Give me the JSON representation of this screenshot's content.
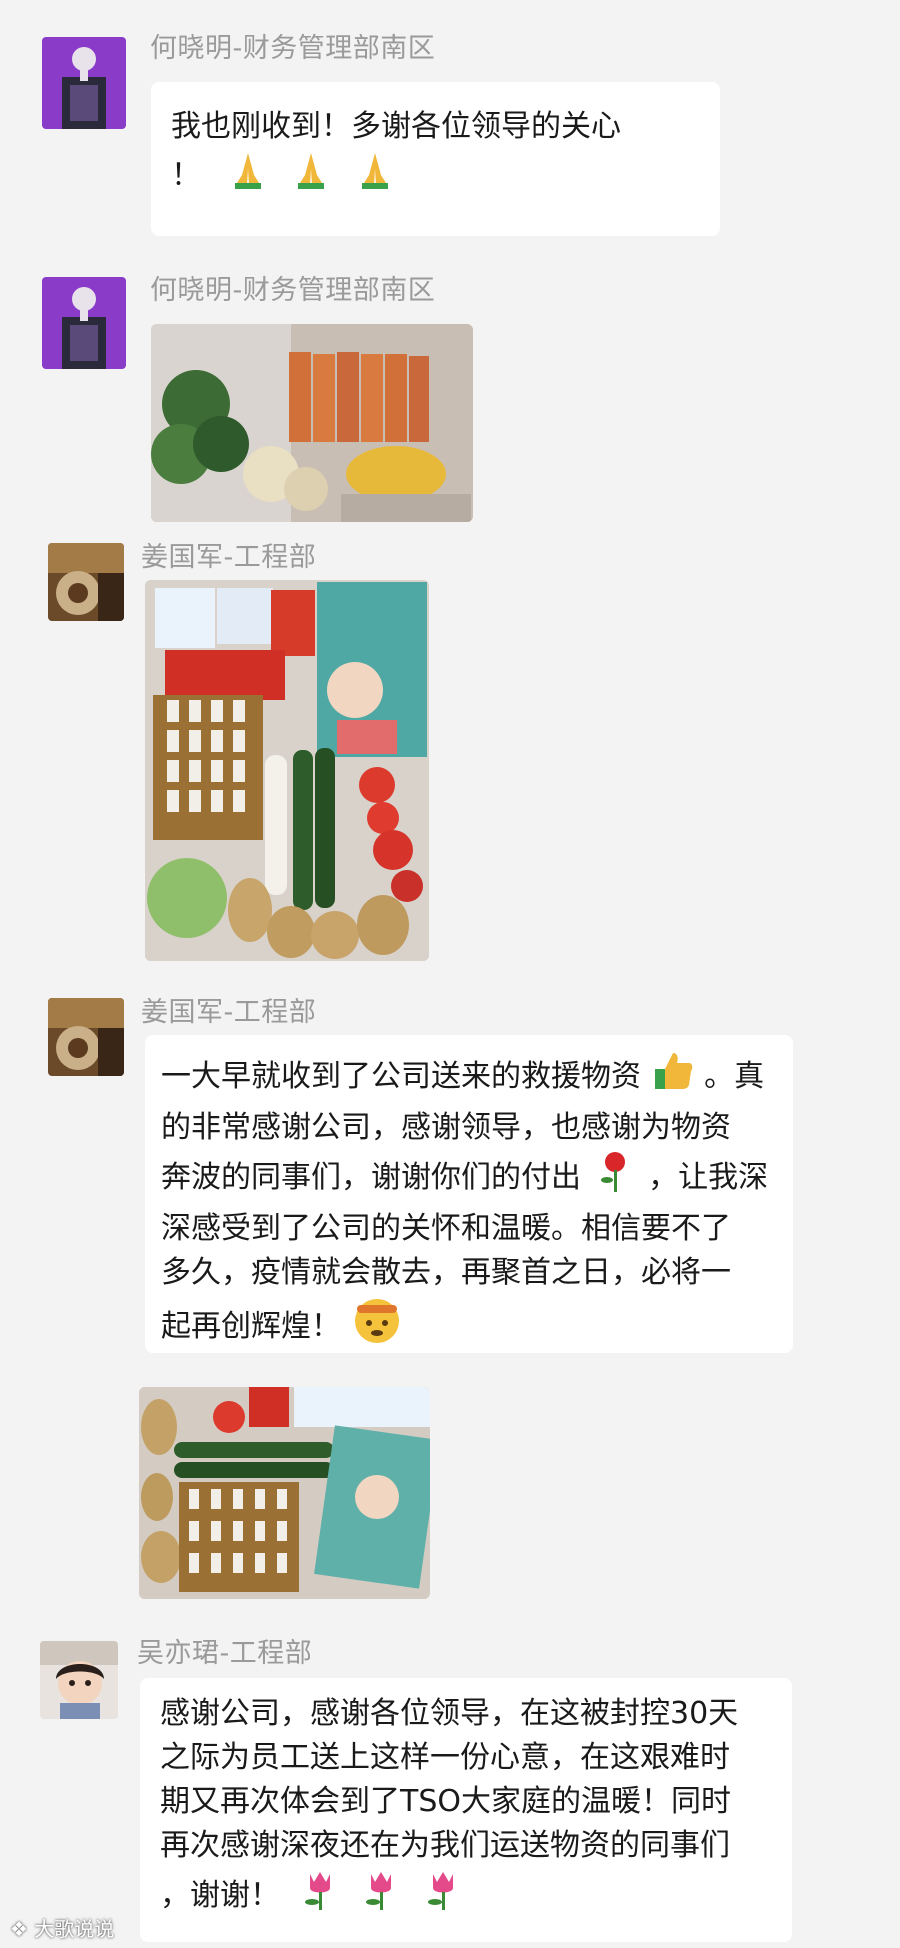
{
  "messages": [
    {
      "sender": "何晓明-财务管理部南区",
      "lines": [
        "我也刚收到！多谢各位领导的关心",
        "！"
      ]
    },
    {
      "sender": "何晓明-财务管理部南区"
    },
    {
      "sender": "姜国军-工程部"
    },
    {
      "sender": "姜国军-工程部",
      "lines": [
        "一大早就收到了公司送来的救援物资",
        "。真",
        "的非常感谢公司，感谢领导，也感谢为物资",
        "奔波的同事们，谢谢你们的付出",
        "，让我深",
        "深感受到了公司的关怀和温暖。相信要不了",
        "多久，疫情就会散去，再聚首之日，必将一",
        "起再创辉煌！"
      ]
    },
    {
      "sender": "吴亦珺-工程部",
      "lines": [
        "感谢公司，感谢各位领导，在这被封控30天",
        "之际为员工送上这样一份心意，在这艰难时",
        "期又再次体会到了TSO大家庭的温暖！同时",
        "再次感谢深夜还在为我们运送物资的同事们",
        "，谢谢！"
      ]
    }
  ],
  "emoji": {
    "prayer": "folded-hands-icon",
    "thumbs": "thumbs-up-icon",
    "rose": "rose-icon",
    "tulip": "tulip-icon",
    "face": "saluting-face-icon"
  },
  "watermark": "大歌说说"
}
